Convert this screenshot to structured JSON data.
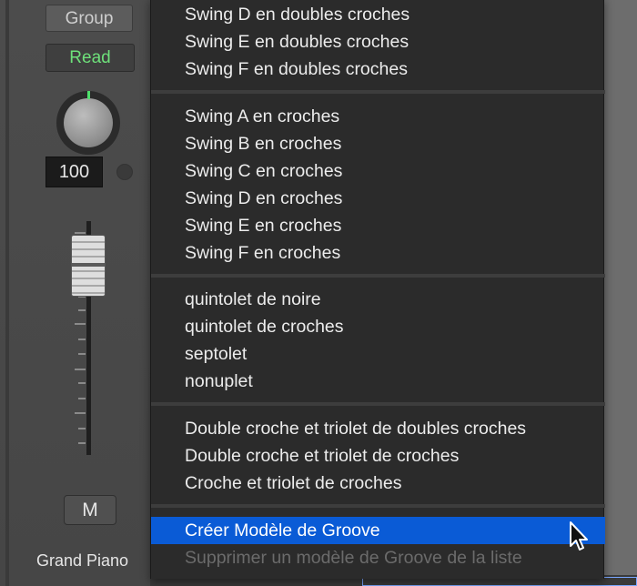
{
  "channel_strip": {
    "group_label": "Group",
    "automation_mode": "Read",
    "knob_value": "100",
    "mute_label": "M",
    "track_name": "Grand Piano"
  },
  "menu": {
    "group1": [
      "Swing D en doubles croches",
      "Swing E en doubles croches",
      "Swing F en doubles croches"
    ],
    "group2": [
      "Swing A en croches",
      "Swing B en croches",
      "Swing C en croches",
      "Swing D en croches",
      "Swing E en croches",
      "Swing F en croches"
    ],
    "group3": [
      "quintolet de noire",
      "quintolet de croches",
      "septolet",
      "nonuplet"
    ],
    "group4": [
      "Double croche et triolet de doubles croches",
      "Double croche et triolet de croches",
      "Croche et triolet de croches"
    ],
    "create_groove": "Créer Modèle de Groove",
    "remove_groove": "Supprimer un modèle de Groove de la liste"
  },
  "colors": {
    "menu_bg": "#2b2b2b",
    "highlight": "#0a5bd6",
    "read_green": "#6ee07a",
    "disabled_text": "#6b6b6b"
  }
}
